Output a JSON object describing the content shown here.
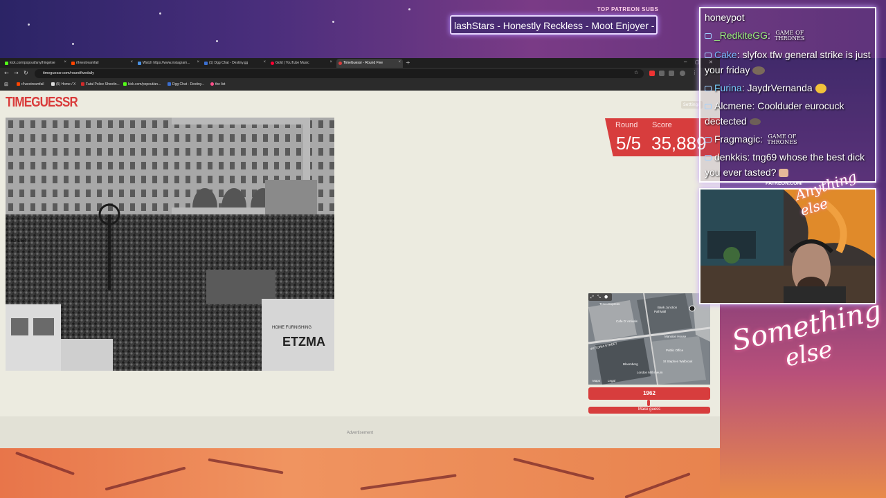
{
  "ticker": {
    "title": "TOP PATREON SUBS",
    "text": "lashStars - Honestly Reckless - Moot Enjoyer -"
  },
  "browser": {
    "tabs": [
      {
        "label": "kick.com/popout/anythingelse",
        "favicon_color": "#53fc18",
        "active": false
      },
      {
        "label": "r/Iwestreamfail",
        "favicon_color": "#ff4500",
        "active": false
      },
      {
        "label": "Watch https://www.instagram...",
        "favicon_color": "#4a90e2",
        "active": false
      },
      {
        "label": "(1) Dgg Chat - Destiny.gg",
        "favicon_color": "#3b6fd1",
        "active": false
      },
      {
        "label": "Gold | YouTube Music",
        "favicon_color": "#ff0033",
        "active": false
      },
      {
        "label": "TimeGuessr - Round Five",
        "favicon_color": "#d73d3d",
        "active": true
      }
    ],
    "url": "timeguessr.com/roundfivedaily",
    "bookmarks": [
      {
        "label": "r/Iwestreamfail",
        "color": "#ff4500"
      },
      {
        "label": "(5) Home / X",
        "color": "#dddddd"
      },
      {
        "label": "Fatal Police Shootin...",
        "color": "#d12a2a"
      },
      {
        "label": "kick.com/popout/an...",
        "color": "#53fc18"
      },
      {
        "label": "Dgg Chat - Destiny...",
        "color": "#3b6fd1"
      },
      {
        "label": "the list",
        "color": "#ff4f8a"
      }
    ]
  },
  "game": {
    "logo": "TIMEGUESSR",
    "settings_label": "Settings",
    "round_label": "Round",
    "score_label": "Score",
    "round_value": "5/5",
    "score_value": "35,889",
    "year_value": "1962",
    "guess_button": "Make guess",
    "ad_label": "Advertisement",
    "photo_signs": {
      "sign_left": "TO LET",
      "sign_truck": "ETZMA",
      "sign_truck_sub": "HOME FURNISHING"
    },
    "map": {
      "labels": [
        "Tesco Express",
        "Pall Mall",
        "Cafe D' Arrivals",
        "VICTORIA STREET",
        "Bank Junction",
        "Mansion House",
        "Public Office",
        "St Stephen Walbrook",
        "Bloomberg",
        "London Mithraeum",
        "Maps",
        "Legal"
      ]
    }
  },
  "colors": {
    "accent": "#d73d3d",
    "page_bg": "#ecebe0"
  },
  "chat": {
    "messages": [
      {
        "user": "",
        "text": "honeypot",
        "user_color": "#ffffff",
        "badge": false,
        "emote": ""
      },
      {
        "user": "_RedkiteGG",
        "text": ":",
        "user_color": "#9cf080",
        "badge": true,
        "emote": "got"
      },
      {
        "user": "Cake",
        "text": ": slyfox tfw general strike is just your friday",
        "user_color": "#78b8ff",
        "badge": true,
        "emote": "rock"
      },
      {
        "user": "Furina",
        "text": ": JaydrVernanda",
        "user_color": "#7ad0ff",
        "badge": true,
        "emote": "smile"
      },
      {
        "user": "Alcmene",
        "text": ": Coolduder eurocuck dectected",
        "user_color": "#ffffff",
        "badge": true,
        "emote": "rock"
      },
      {
        "user": "Fragmagic",
        "text": ":",
        "user_color": "#ffffff",
        "badge": true,
        "emote": "got"
      },
      {
        "user": "denkkis",
        "text": ": tng69 whose the best dick you ever tasted?",
        "user_color": "#ffffff",
        "badge": true,
        "emote": "hand"
      }
    ],
    "got_text": "GAME OF THRONES"
  },
  "overlay": {
    "patreon_label": "PATREON.COM/",
    "anything_else": "Anything else",
    "something_line1": "Something",
    "something_line2": "else"
  }
}
